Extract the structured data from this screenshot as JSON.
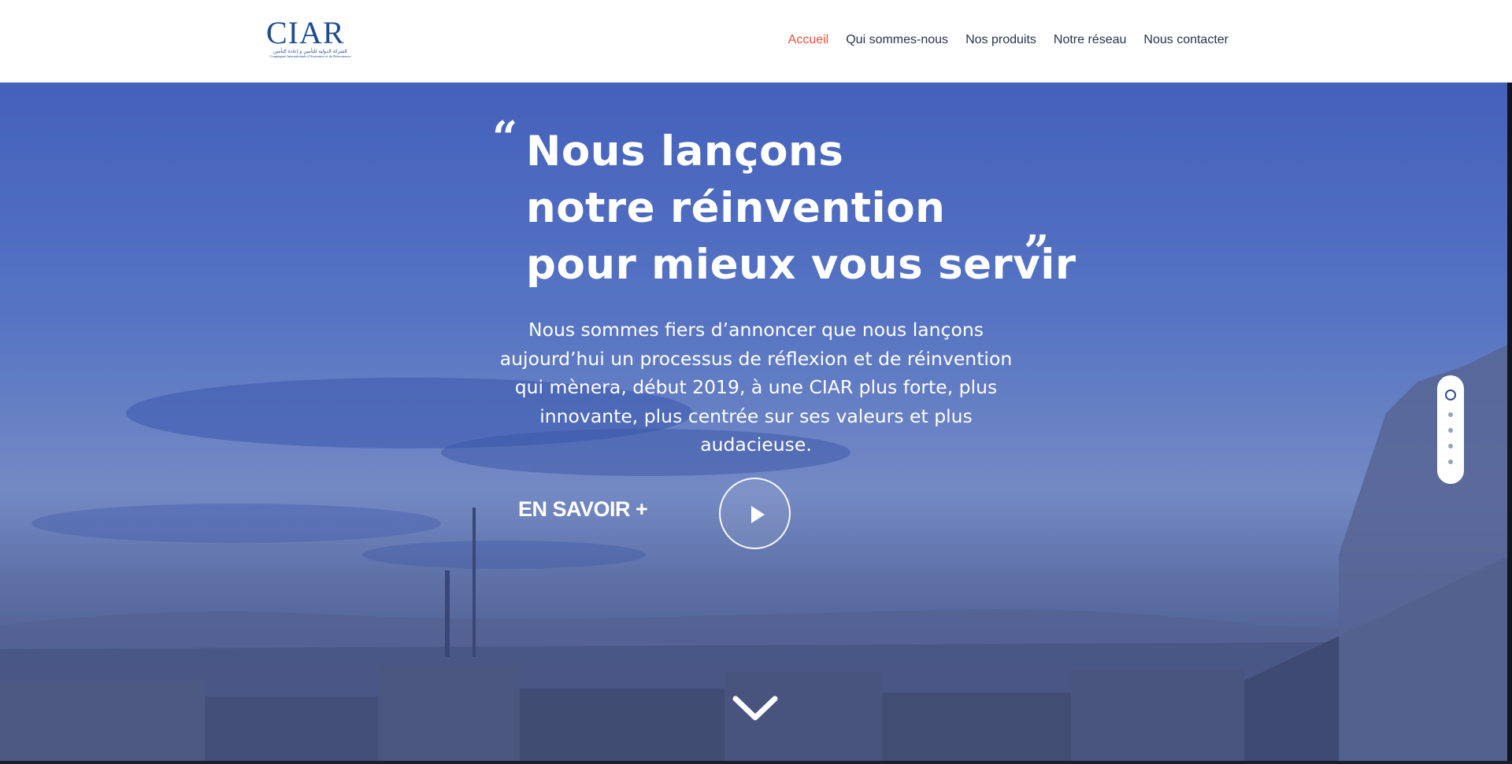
{
  "header": {
    "logo": {
      "text": "CIAR",
      "arabic": "الشركة الدولية للتأمين و إعادة التأمين",
      "subtitle": "Compagnie Internationale d'Assurance et de Réassurance"
    },
    "nav": [
      {
        "label": "Accueil",
        "active": true
      },
      {
        "label": "Qui sommes-nous",
        "active": false
      },
      {
        "label": "Nos produits",
        "active": false
      },
      {
        "label": "Notre réseau",
        "active": false
      },
      {
        "label": "Nous contacter",
        "active": false
      }
    ],
    "active_color": "#e2533b"
  },
  "hero": {
    "quote_open": "“",
    "quote_close": "”",
    "headline": [
      "Nous lançons",
      "notre réinvention",
      "pour mieux vous servir"
    ],
    "intro": "Nous sommes fiers d’annoncer que nous lançons aujourd’hui un processus de réflexion et de réinvention qui mènera, début 2019, à une CIAR plus forte, plus innovante, plus centrée sur ses valeurs et plus audacieuse.",
    "cta_label": "EN SAVOIR +",
    "play_icon": "play-icon",
    "scroll_icon": "chevron-down-icon"
  },
  "slider": {
    "total": 5,
    "active_index": 0
  }
}
